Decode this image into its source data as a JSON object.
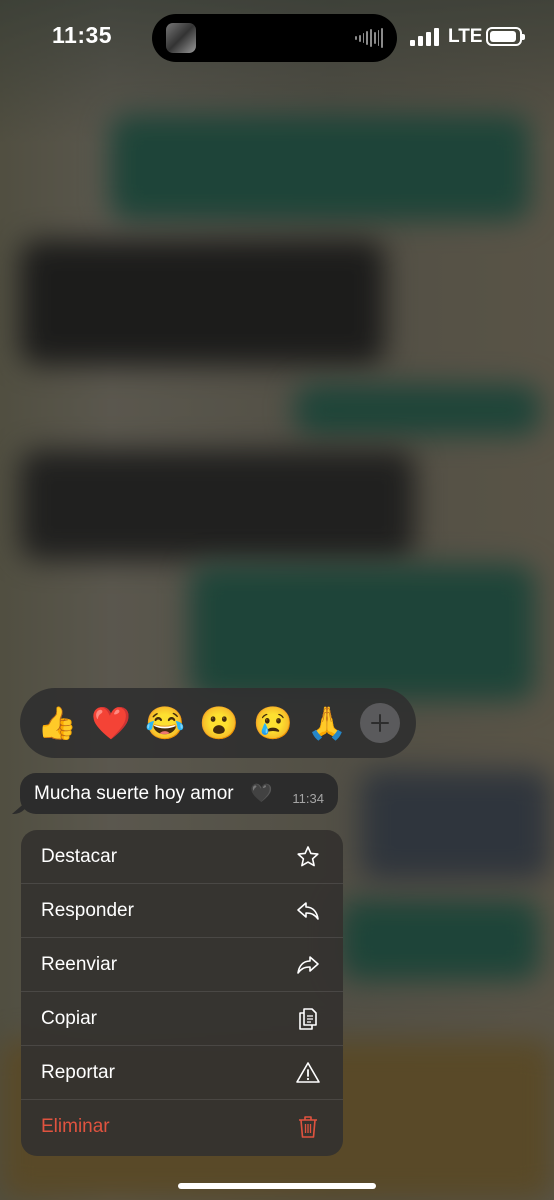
{
  "status_bar": {
    "time": "11:35",
    "network": "LTE"
  },
  "reactions": {
    "items": [
      {
        "emoji": "👍",
        "name": "thumbs-up"
      },
      {
        "emoji": "❤️",
        "name": "heart"
      },
      {
        "emoji": "😂",
        "name": "tears-of-joy"
      },
      {
        "emoji": "😮",
        "name": "surprised"
      },
      {
        "emoji": "😢",
        "name": "crying"
      },
      {
        "emoji": "🙏",
        "name": "folded-hands"
      }
    ],
    "more_icon": "plus-icon"
  },
  "message": {
    "text": "Mucha suerte hoy amor",
    "emoji": "🖤",
    "time": "11:34"
  },
  "menu": {
    "items": [
      {
        "label": "Destacar",
        "icon": "star-icon"
      },
      {
        "label": "Responder",
        "icon": "reply-icon"
      },
      {
        "label": "Reenviar",
        "icon": "forward-icon"
      },
      {
        "label": "Copiar",
        "icon": "copy-icon"
      },
      {
        "label": "Reportar",
        "icon": "warning-icon"
      },
      {
        "label": "Eliminar",
        "icon": "trash-icon",
        "destructive": true
      }
    ]
  },
  "colors": {
    "menu_text": "#ffffff",
    "destructive": "#e0533f",
    "bubble": "#2c2c2c",
    "menu_bg": "#343230"
  }
}
